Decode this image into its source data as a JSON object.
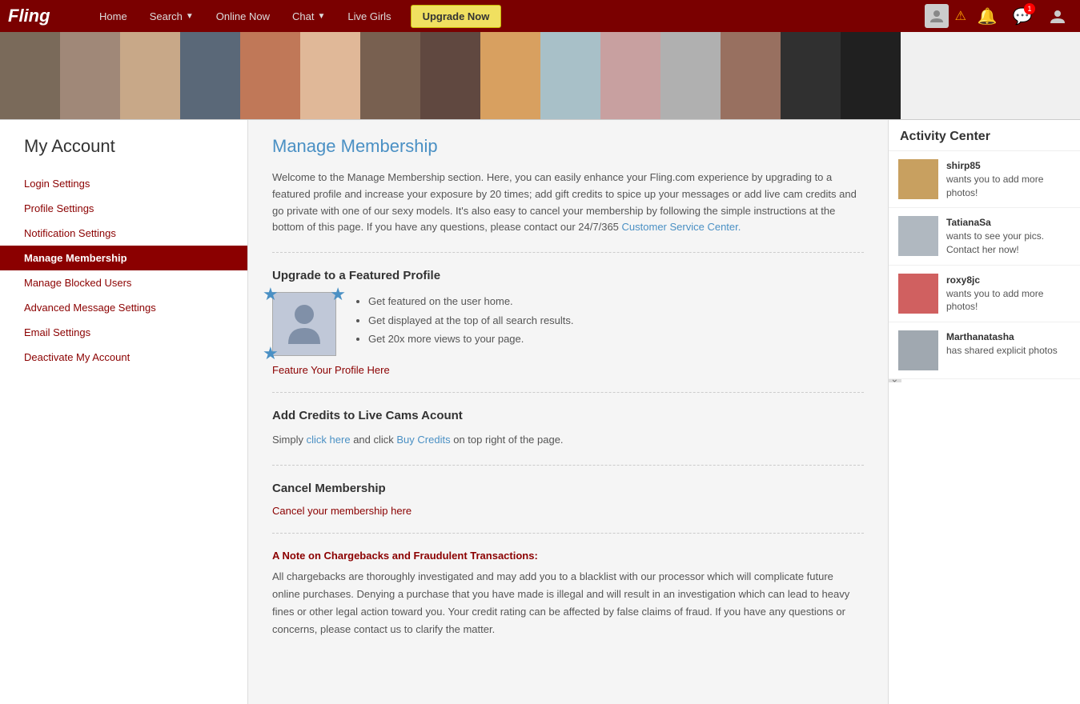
{
  "navbar": {
    "logo": "Fling",
    "links": [
      {
        "label": "Home",
        "has_arrow": false
      },
      {
        "label": "Search",
        "has_arrow": true
      },
      {
        "label": "Online Now",
        "has_arrow": false
      },
      {
        "label": "Chat",
        "has_arrow": true
      },
      {
        "label": "Live Girls",
        "has_arrow": false
      }
    ],
    "upgrade_btn": "Upgrade Now",
    "notification_count": "1"
  },
  "photo_strip": {
    "count": 15
  },
  "sidebar": {
    "title": "My Account",
    "items": [
      {
        "label": "Login Settings",
        "active": false
      },
      {
        "label": "Profile Settings",
        "active": false
      },
      {
        "label": "Notification Settings",
        "active": false
      },
      {
        "label": "Manage Membership",
        "active": true
      },
      {
        "label": "Manage Blocked Users",
        "active": false
      },
      {
        "label": "Advanced Message Settings",
        "active": false
      },
      {
        "label": "Email Settings",
        "active": false
      },
      {
        "label": "Deactivate My Account",
        "active": false
      }
    ]
  },
  "main": {
    "title": "Manage Membership",
    "intro": "Welcome to the Manage Membership section. Here, you can easily enhance your Fling.com experience by upgrading to a featured profile and increase your exposure by 20 times; add gift credits to spice up your messages or add live cam credits and go private with one of our sexy models. It's also easy to cancel your membership by following the simple instructions at the bottom of this page. If you have any questions, please contact our 24/7/365",
    "intro_link": "Customer Service Center.",
    "section1": {
      "title": "Upgrade to a Featured Profile",
      "bullets": [
        "Get featured on the user home.",
        "Get displayed at the top of all search results.",
        "Get 20x more views to your page."
      ],
      "link": "Feature Your Profile Here"
    },
    "section2": {
      "title": "Add Credits to Live Cams Acount",
      "text_before": "Simply",
      "link1": "click here",
      "text_middle": "and click",
      "link2": "Buy Credits",
      "text_after": "on top right of the page."
    },
    "section3": {
      "title": "Cancel Membership",
      "link": "Cancel your membership here"
    },
    "section4": {
      "title": "A Note on Chargebacks and Fraudulent Transactions:",
      "text": "All chargebacks are thoroughly investigated and may add you to a blacklist with our processor which will complicate future online purchases. Denying a purchase that you have made is illegal and will result in an investigation which can lead to heavy fines or other legal action toward you. Your credit rating can be affected by false claims of fraud. If you have any questions or concerns, please contact us to clarify the matter."
    }
  },
  "activity": {
    "title": "Activity Center",
    "items": [
      {
        "username": "shirp85",
        "message": "wants you to add more photos!",
        "avatar_class": "a1"
      },
      {
        "username": "TatianaSa",
        "message": "wants to see your pics. Contact her now!",
        "avatar_class": "a2"
      },
      {
        "username": "roxy8jc",
        "message": "wants you to add more photos!",
        "avatar_class": "a3"
      },
      {
        "username": "Marthanatasha",
        "message": "has shared explicit photos",
        "avatar_class": "a4"
      }
    ]
  }
}
